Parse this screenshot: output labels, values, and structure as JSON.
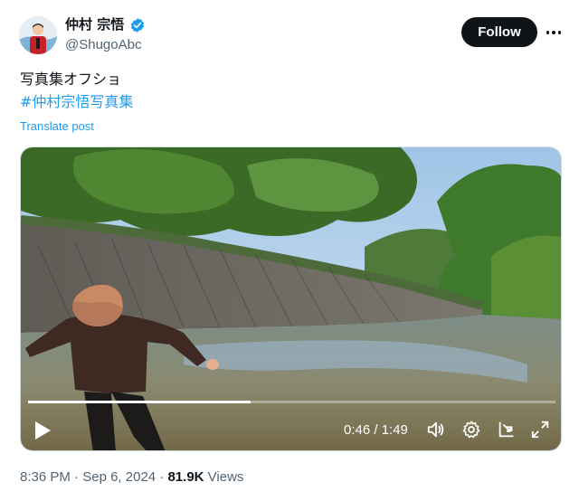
{
  "author": {
    "display_name": "仲村 宗悟",
    "handle": "@ShugoAbc",
    "verified_icon": "verified-badge-icon",
    "badge_color": "#1d9bf0"
  },
  "actions": {
    "follow_label": "Follow",
    "more_icon": "more-horizontal-icon"
  },
  "post": {
    "text": "写真集オフショ",
    "hashtag": "#仲村宗悟写真集",
    "translate_label": "Translate post"
  },
  "video": {
    "current_time": "0:46",
    "duration": "1:49",
    "time_display": "0:46 / 1:49",
    "progress": 0.422,
    "controls": [
      "play-icon",
      "volume-icon",
      "settings-icon",
      "picture-in-picture-icon",
      "fullscreen-icon"
    ]
  },
  "meta": {
    "time": "8:36 PM",
    "separator": "·",
    "date": "Sep 6, 2024",
    "views_count": "81.9K",
    "views_label": "Views"
  },
  "colors": {
    "accent": "#1d9bf0",
    "text": "#0f1419",
    "secondary": "#536471",
    "button": "#0f1419"
  }
}
